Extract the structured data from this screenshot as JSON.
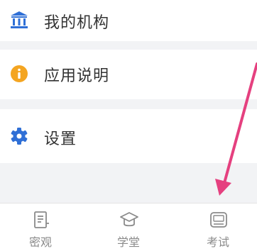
{
  "menu": {
    "items": [
      {
        "label": "我的机构",
        "icon": "institution-icon"
      },
      {
        "label": "应用说明",
        "icon": "info-icon"
      },
      {
        "label": "设置",
        "icon": "gear-icon"
      }
    ]
  },
  "tabbar": {
    "tabs": [
      {
        "label": "密观",
        "icon": "document-icon"
      },
      {
        "label": "学堂",
        "icon": "graduation-cap-icon"
      },
      {
        "label": "考试",
        "icon": "exam-icon"
      }
    ]
  },
  "colors": {
    "accent_blue": "#2f6fd6",
    "info_orange": "#f4a521",
    "arrow_pink": "#e5407f",
    "tab_gray": "#8a8a8a"
  }
}
